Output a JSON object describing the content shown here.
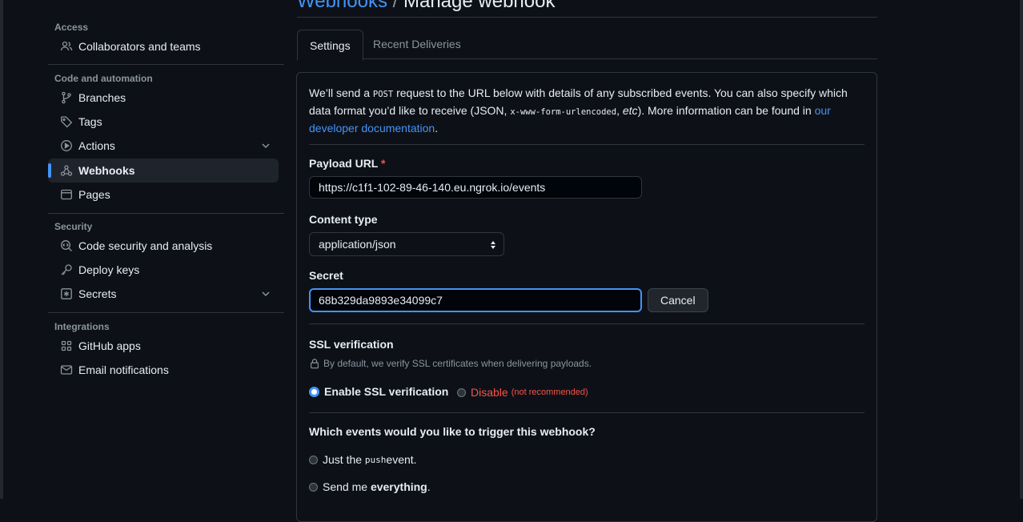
{
  "breadcrumb": {
    "parent": "Webhooks",
    "separator": "/",
    "current": "Manage webhook"
  },
  "sidebar": {
    "sections": {
      "access": "Access",
      "code": "Code and automation",
      "security": "Security",
      "integrations": "Integrations"
    },
    "items": {
      "collaborators": "Collaborators and teams",
      "branches": "Branches",
      "tags": "Tags",
      "actions": "Actions",
      "webhooks": "Webhooks",
      "pages": "Pages",
      "code_security": "Code security and analysis",
      "deploy_keys": "Deploy keys",
      "secrets": "Secrets",
      "github_apps": "GitHub apps",
      "email_notifications": "Email notifications"
    },
    "active": "webhooks"
  },
  "tabs": {
    "settings": "Settings",
    "recent": "Recent Deliveries"
  },
  "intro": {
    "p1": "We’ll send a ",
    "post": "POST",
    "p2": " request to the URL below with details of any subscribed events. You can also specify which data format you’d like to receive (JSON, ",
    "urlencoded": "x-www-form-urlencoded",
    "p3": ", ",
    "etc": "etc",
    "p4": "). More information can be found in ",
    "link": "our developer documentation",
    "p5": "."
  },
  "form": {
    "payload_label": "Payload URL",
    "required_mark": "*",
    "payload_value": "https://c1f1-102-89-46-140.eu.ngrok.io/events",
    "content_type_label": "Content type",
    "content_type_value": "application/json",
    "secret_label": "Secret",
    "secret_value": "68b329da9893e34099c7",
    "cancel": "Cancel"
  },
  "ssl": {
    "title": "SSL verification",
    "note": "By default, we verify SSL certificates when delivering payloads.",
    "enable": "Enable SSL verification",
    "disable": "Disable",
    "not_recommended": "(not recommended)",
    "selected": "enable"
  },
  "events": {
    "question": "Which events would you like to trigger this webhook?",
    "opt1_a": "Just the ",
    "opt1_code": "push",
    "opt1_b": " event.",
    "opt2_a": "Send me ",
    "opt2_b": "everything",
    "opt2_c": "."
  },
  "colors": {
    "bg": "#0d1117",
    "accent": "#4493f8",
    "danger": "#f85149",
    "muted": "#8b949e",
    "border": "#30363d"
  }
}
